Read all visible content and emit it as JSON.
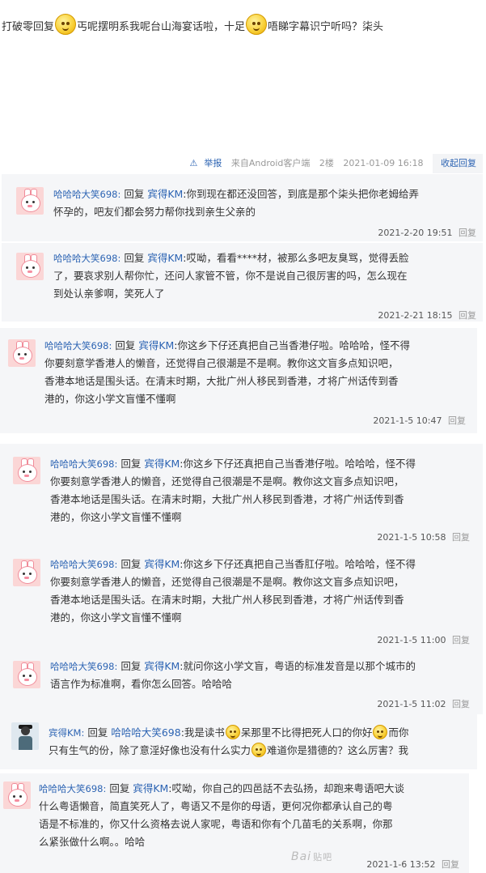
{
  "post": {
    "text_part1": "打破零回复",
    "text_part2": "丐呢摆明系我呢台山海宴话啦，十足",
    "text_part3": "唔睇字幕识宁听吗？柒头",
    "report_label": "举报",
    "source_label": "来自Android客户端",
    "floor": "2楼",
    "time": "2021-01-09 16:18",
    "collapse_label": "收起回复"
  },
  "replies": [
    {
      "user": "哈哈哈大笑698:",
      "reply_word": "回复",
      "target": "宾得KM",
      "line1": ":你到现在都还没回答，到底是那个柒头把你老姆给弄",
      "line2": "怀孕的，吧友们都会努力帮你找到亲生父亲的",
      "time": "2021-2-20 19:51",
      "reply_label": "回复"
    },
    {
      "user": "哈哈哈大笑698:",
      "reply_word": "回复",
      "target": "宾得KM",
      "line1": ":哎呦，看看****材，被那么多吧友臭骂，觉得丢脸",
      "line2": "了，要哀求别人帮你忙，还问人家管不管，你不是说自己很厉害的吗，怎么现在",
      "line3": "到处认亲爹啊，笑死人了",
      "time": "2021-2-21 18:15",
      "reply_label": "回复"
    },
    {
      "user": "哈哈哈大笑698:",
      "reply_word": "回复",
      "target": "宾得KM",
      "line1": ":你这乡下仔还真把自己当香港仔啦。哈哈哈，怪不得",
      "line2": "你要刻意学香港人的懒音，还觉得自己很潮是不是啊。教你这文盲多点知识吧，",
      "line3": "香港本地话是围头话。在清末时期，大批广州人移民到香港，才将广州话传到香",
      "line4": "港的，你这小学文盲懂不懂啊",
      "time": "2021-1-5 10:47",
      "reply_label": "回复"
    },
    {
      "user": "哈哈哈大笑698:",
      "reply_word": "回复",
      "target": "宾得KM",
      "line1": ":你这乡下仔还真把自己当香港仔啦。哈哈哈，怪不得",
      "line2": "你要刻意学香港人的懒音，还觉得自己很潮是不是啊。教你这文盲多点知识吧，",
      "line3": "香港本地话是围头话。在清末时期，大批广州人移民到香港，才将广州话传到香",
      "line4": "港的，你这小学文盲懂不懂啊",
      "time": "2021-1-5 10:58",
      "reply_label": "回复"
    },
    {
      "user": "哈哈哈大笑698:",
      "reply_word": "回复",
      "target": "宾得KM",
      "line1": ":你这乡下仔还真把自己当香肛仔啦。哈哈哈，怪不得",
      "line2": "你要刻意学香港人的懒音，还觉得自己很潮是不是啊。教你这文盲多点知识吧，",
      "line3": "香港本地话是围头话。在清末时期，大批广州人移民到香港，才将广州话传到香",
      "line4": "港的，你这小学文盲懂不懂啊",
      "time": "2021-1-5 11:00",
      "reply_label": "回复"
    },
    {
      "user": "哈哈哈大笑698:",
      "reply_word": "回复",
      "target": "宾得KM",
      "line1": ":就问你这小学文盲，粤语的标准发音是以那个城市的",
      "line2": "语言作为标准啊，看你怎么回答。哈哈哈",
      "time": "2021-1-5 11:02",
      "reply_label": "回复"
    },
    {
      "user": "宾得KM:",
      "reply_word": "回复",
      "target": "哈哈哈大笑698",
      "line1a": ":我是读书",
      "line1b": "呆那里不比得把死人口的你好",
      "line1c": "而你",
      "line2a": "只有生气的份，除了意淫好像也没有什么实力",
      "line2b": "难道你是猎德的？这么厉害？我"
    },
    {
      "user": "哈哈哈大笑698:",
      "reply_word": "回复",
      "target": "宾得KM",
      "line1": ":哎呦，你自己的四邑話不去弘扬，却跑来粤语吧大谈",
      "line2": "什么粤语懒音，简直笑死人了，粤语又不是你的母语，更何况你都承认自己的粤",
      "line3": "语是不标准的，你又什么资格去说人家呢，粤语和你有个几苗毛的关系啊，你那",
      "line4": "么紧张做什么啊。。哈哈",
      "time": "2021-1-6 13:52",
      "reply_label": "回复"
    }
  ],
  "watermark": {
    "brand": "Bai",
    "sub": "贴吧"
  },
  "icons": {
    "report": "warning-triangle-icon",
    "emoji": "smiley-emoji-icon",
    "avatar_rabbit": "rabbit-avatar",
    "avatar_person": "person-avatar"
  }
}
